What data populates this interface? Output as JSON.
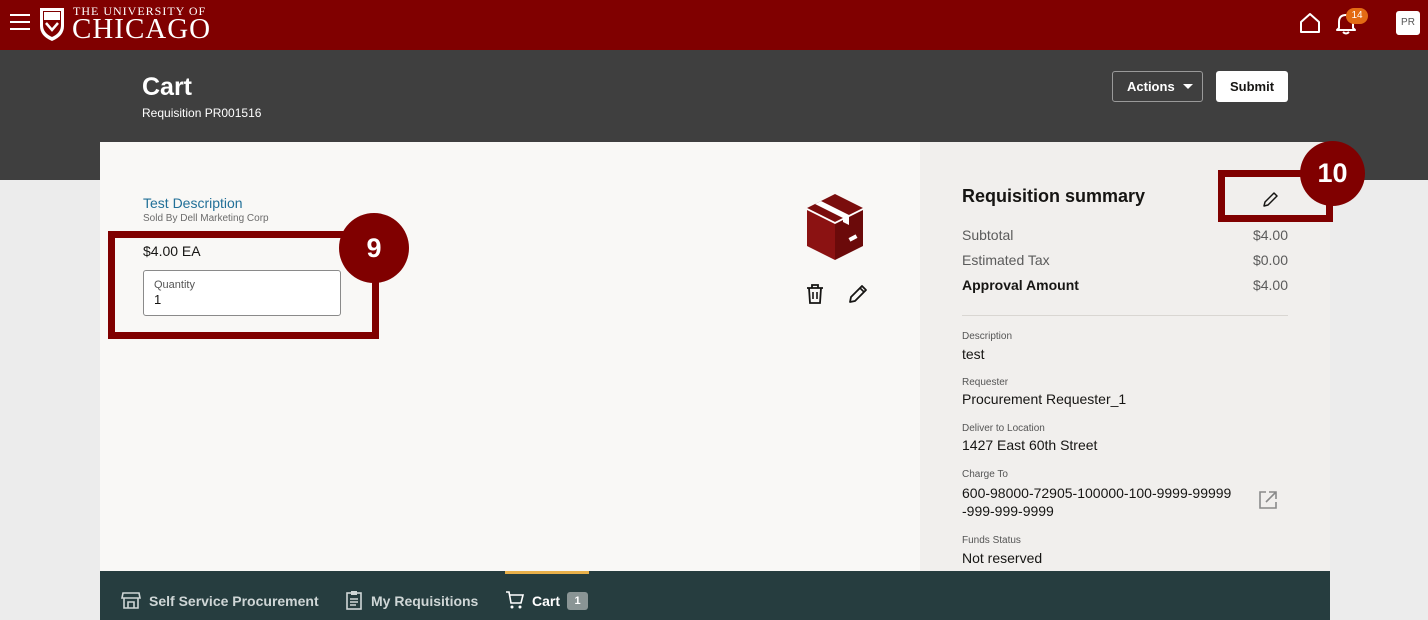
{
  "topbar": {
    "logo_line1": "THE UNIVERSITY OF",
    "logo_line2": "CHICAGO",
    "notification_count": "14",
    "avatar_initials": "PR",
    "brand_color": "#800000"
  },
  "header": {
    "title": "Cart",
    "subtitle": "Requisition PR001516",
    "actions_label": "Actions",
    "submit_label": "Submit"
  },
  "item": {
    "title": "Test Description",
    "seller": "Sold By Dell Marketing Corp",
    "price": "$4.00 EA",
    "quantity_label": "Quantity",
    "quantity_value": "1"
  },
  "annotations": {
    "step_a": "9",
    "step_b": "10"
  },
  "summary": {
    "title": "Requisition summary",
    "subtotal_label": "Subtotal",
    "subtotal_value": "$4.00",
    "tax_label": "Estimated Tax",
    "tax_value": "$0.00",
    "approval_label": "Approval Amount",
    "approval_value": "$4.00",
    "description_label": "Description",
    "description_value": "test",
    "requester_label": "Requester",
    "requester_value": "Procurement Requester_1",
    "deliver_label": "Deliver to Location",
    "deliver_value": "1427 East 60th Street",
    "charge_label": "Charge To",
    "charge_value": "600-98000-72905-100000-100-9999-99999-999-999-9999",
    "funds_label": "Funds Status",
    "funds_value": "Not reserved"
  },
  "bottom_nav": {
    "items": [
      {
        "label": "Self Service Procurement",
        "icon": "store-icon"
      },
      {
        "label": "My Requisitions",
        "icon": "clipboard-icon"
      },
      {
        "label": "Cart",
        "icon": "cart-icon"
      }
    ],
    "cart_count": "1"
  }
}
